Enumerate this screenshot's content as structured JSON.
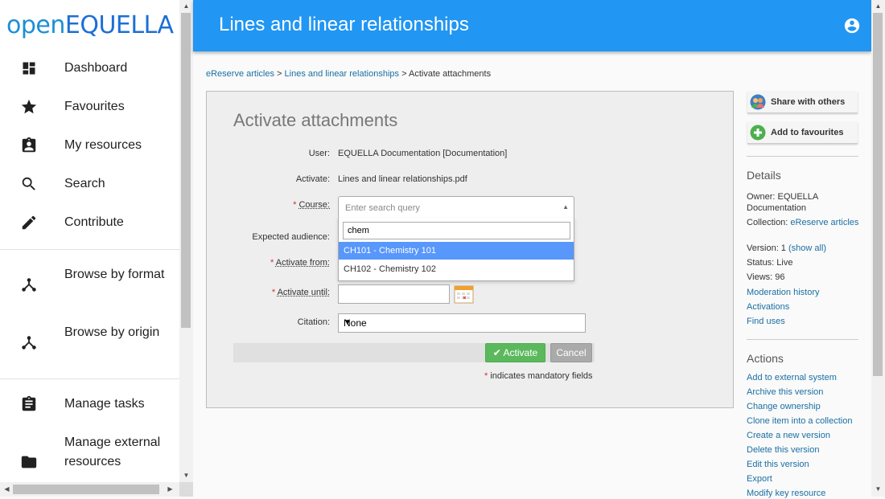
{
  "logo": {
    "part1": "open",
    "part2": "EQUELLA"
  },
  "nav": {
    "items": [
      {
        "label": "Dashboard",
        "icon": "dashboard-icon"
      },
      {
        "label": "Favourites",
        "icon": "star-icon"
      },
      {
        "label": "My resources",
        "icon": "assignment-ind-icon"
      },
      {
        "label": "Search",
        "icon": "search-icon"
      },
      {
        "label": "Contribute",
        "icon": "pencil-icon"
      },
      {
        "label": "Browse by format",
        "icon": "hierarchy-icon"
      },
      {
        "label": "Browse by origin",
        "icon": "hierarchy-icon"
      },
      {
        "label": "Manage tasks",
        "icon": "clipboard-icon"
      },
      {
        "label": "Manage external resources",
        "icon": "folder-icon"
      }
    ]
  },
  "appbar": {
    "title": "Lines and linear relationships"
  },
  "breadcrumb": {
    "link1": "eReserve articles",
    "link2": "Lines and linear relationships",
    "sep": ">",
    "current": "Activate attachments"
  },
  "form": {
    "heading": "Activate attachments",
    "user_label": "User:",
    "user_value": "EQUELLA Documentation [Documentation]",
    "activate_label": "Activate:",
    "activate_value": "Lines and linear relationships.pdf",
    "required_mark": "*",
    "course_label": "Course:",
    "course_placeholder": "Enter search query",
    "search_value": "chem",
    "options": [
      "CH101 - Chemistry 101",
      "CH102 - Chemistry 102"
    ],
    "audience_label": "Expected audience:",
    "from_label": "Activate from:",
    "until_label": "Activate until:",
    "citation_label": "Citation:",
    "citation_value": "None",
    "activate_button": "Activate",
    "cancel_button": "Cancel",
    "mandatory_note": "indicates mandatory fields"
  },
  "sidebar": {
    "share": "Share with others",
    "favourite": "Add to favourites",
    "details_heading": "Details",
    "owner": "Owner: EQUELLA Documentation",
    "collection_label": "Collection:",
    "collection_link": "eReserve articles",
    "version_label": "Version: 1",
    "version_link": "(show all)",
    "status": "Status: Live",
    "views": "Views: 96",
    "links": [
      "Moderation history",
      "Activations",
      "Find uses"
    ],
    "actions_heading": "Actions",
    "actions": [
      "Add to external system",
      "Archive this version",
      "Change ownership",
      "Clone item into a collection",
      "Create a new version",
      "Delete this version",
      "Edit this version",
      "Export",
      "Modify key resource"
    ]
  },
  "colors": {
    "appbar": "#2196f3",
    "logo": "#1c8fd6",
    "activate": "#5cb85c",
    "highlight": "#5897fb"
  }
}
